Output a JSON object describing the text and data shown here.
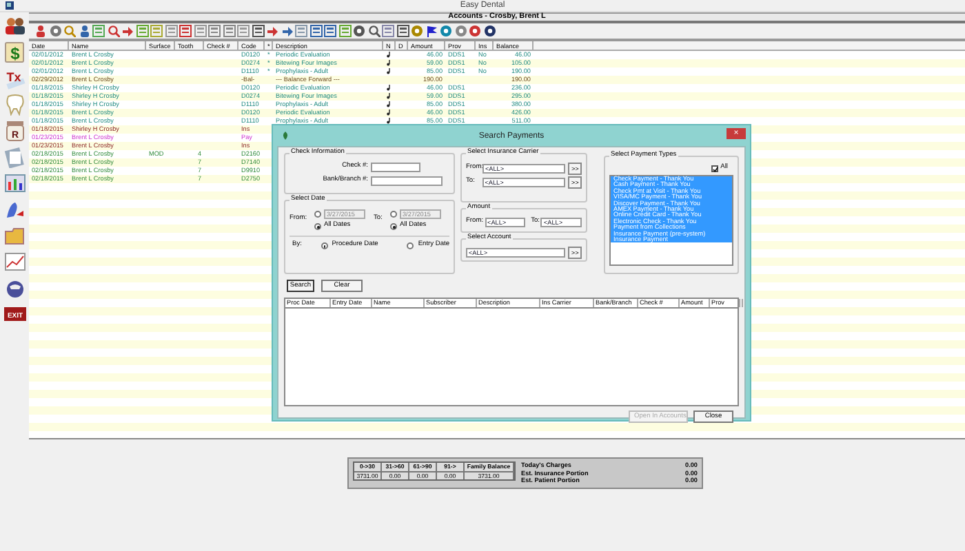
{
  "window": {
    "title": "Easy Dental"
  },
  "sidebar_labels": {
    "ledger": "$",
    "treatment": "Tx",
    "rx": "R",
    "exit": "EXIT"
  },
  "account_title": "Accounts - Crosby, Brent L",
  "ledger": {
    "columns": [
      "Date",
      "Name",
      "Surface",
      "Tooth",
      "Check #",
      "Code",
      "*",
      "Description",
      "N",
      "D",
      "Amount",
      "Prov",
      "Ins",
      "Balance"
    ],
    "rows": [
      {
        "kind": "completed",
        "date": "02/01/2012",
        "name": "Brent L Crosby",
        "code": "D0120",
        "star": "*",
        "description": "Periodic Evaluation",
        "note": true,
        "amount": "46.00",
        "prov": "DDS1",
        "ins": "No",
        "balance": "46.00"
      },
      {
        "kind": "completed",
        "date": "02/01/2012",
        "name": "Brent L Crosby",
        "code": "D0274",
        "star": "*",
        "description": "Bitewing Four Images",
        "note": true,
        "amount": "59.00",
        "prov": "DDS1",
        "ins": "No",
        "balance": "105.00"
      },
      {
        "kind": "completed",
        "date": "02/01/2012",
        "name": "Brent L Crosby",
        "code": "D1110",
        "star": "*",
        "description": "Prophylaxis - Adult",
        "note": true,
        "amount": "85.00",
        "prov": "DDS1",
        "ins": "No",
        "balance": "190.00"
      },
      {
        "kind": "balance",
        "date": "02/29/2012",
        "name": "Brent L Crosby",
        "code": "-Bal-",
        "description": "--- Balance Forward ---",
        "note": false,
        "amount": "190.00",
        "balance": "190.00"
      },
      {
        "kind": "completed",
        "date": "01/18/2015",
        "name": "Shirley H Crosby",
        "code": "D0120",
        "description": "Periodic Evaluation",
        "note": true,
        "amount": "46.00",
        "prov": "DDS1",
        "balance": "236.00"
      },
      {
        "kind": "completed",
        "date": "01/18/2015",
        "name": "Shirley H Crosby",
        "code": "D0274",
        "description": "Bitewing Four Images",
        "note": true,
        "amount": "59.00",
        "prov": "DDS1",
        "balance": "295.00"
      },
      {
        "kind": "completed",
        "date": "01/18/2015",
        "name": "Shirley H Crosby",
        "code": "D1110",
        "description": "Prophylaxis - Adult",
        "note": true,
        "amount": "85.00",
        "prov": "DDS1",
        "balance": "380.00"
      },
      {
        "kind": "completed",
        "date": "01/18/2015",
        "name": "Brent L Crosby",
        "code": "D0120",
        "description": "Periodic Evaluation",
        "note": true,
        "amount": "46.00",
        "prov": "DDS1",
        "balance": "426.00"
      },
      {
        "kind": "completed",
        "date": "01/18/2015",
        "name": "Brent L Crosby",
        "code": "D1110",
        "description": "Prophylaxis - Adult",
        "note": true,
        "amount": "85.00",
        "prov": "DDS1",
        "balance": "511.00"
      },
      {
        "kind": "insurance",
        "date": "01/18/2015",
        "name": "Shirley H Crosby",
        "code": "Ins"
      },
      {
        "kind": "payment",
        "date": "01/23/2015",
        "name": "Brent L Crosby",
        "code": "Pay"
      },
      {
        "kind": "insurance",
        "date": "01/23/2015",
        "name": "Brent L Crosby",
        "code": "Ins"
      },
      {
        "kind": "planned",
        "date": "02/18/2015",
        "name": "Brent L Crosby",
        "surface": "MOD",
        "tooth": "4",
        "code": "D2160"
      },
      {
        "kind": "planned",
        "date": "02/18/2015",
        "name": "Brent L Crosby",
        "tooth": "7",
        "code": "D7140"
      },
      {
        "kind": "planned",
        "date": "02/18/2015",
        "name": "Brent L Crosby",
        "tooth": "7",
        "code": "D9910"
      },
      {
        "kind": "planned",
        "date": "02/18/2015",
        "name": "Brent L Crosby",
        "tooth": "7",
        "code": "D2750"
      }
    ]
  },
  "summary": {
    "aging_columns": [
      "0->30",
      "31->60",
      "61->90",
      "91->",
      "Family Balance"
    ],
    "aging_values": [
      "3731.00",
      "0.00",
      "0.00",
      "0.00",
      "3731.00"
    ],
    "totals": [
      {
        "label": "Today's Charges",
        "value": "0.00"
      },
      {
        "label": "Est. Insurance Portion",
        "value": "0.00"
      },
      {
        "label": "Est. Patient Portion",
        "value": "0.00"
      }
    ]
  },
  "dialog": {
    "title": "Search Payments",
    "close": "×",
    "check_info": {
      "title": "Check Information",
      "check_label": "Check #:",
      "bank_label": "Bank/Branch #:"
    },
    "select_date": {
      "title": "Select Date",
      "from_label": "From:",
      "to_label": "To:",
      "from": {
        "specific_selected": false,
        "date": "3/27/2015",
        "all_label": "All Dates",
        "all_selected": true
      },
      "to": {
        "specific_selected": false,
        "date": "3/27/2015",
        "all_label": "All Dates",
        "all_selected": true
      },
      "by_label": "By:",
      "by_options": [
        {
          "label": "Procedure Date",
          "selected": true
        },
        {
          "label": "Entry Date",
          "selected": false
        }
      ]
    },
    "search_button": "Search",
    "clear_button": "Clear",
    "insurance": {
      "title": "Select Insurance Carrier",
      "from_label": "From:",
      "from_value": "<ALL>",
      "to_label": "To:",
      "to_value": "<ALL>",
      "more": ">>"
    },
    "amount": {
      "title": "Amount",
      "from_label": "From:",
      "from_value": "<ALL>",
      "to_label": "To:",
      "to_value": "<ALL>"
    },
    "account": {
      "title": "Select Account",
      "value": "<ALL>",
      "more": ">>"
    },
    "payment_types": {
      "title": "Select Payment Types",
      "all_label": "All",
      "all_checked": true,
      "items": [
        {
          "label": "Check Payment - Thank You",
          "selected": true
        },
        {
          "label": "Cash Payment - Thank You",
          "selected": true
        },
        {
          "label": "Check Pmt at Visit - Thank You",
          "selected": true
        },
        {
          "label": "VISA/MC Payment - Thank You",
          "selected": true
        },
        {
          "label": "Discover Payment - Thank You",
          "selected": true
        },
        {
          "label": "AMEX Payment - Thank You",
          "selected": true
        },
        {
          "label": "Online Credit Card - Thank You",
          "selected": true
        },
        {
          "label": "Electronic Check - Thank You",
          "selected": true
        },
        {
          "label": "Payment from Collections",
          "selected": true
        },
        {
          "label": "Insurance Payment (pre-system)",
          "selected": true
        },
        {
          "label": "Insurance Payment",
          "selected": true
        }
      ]
    },
    "results_columns": [
      "Proc Date",
      "Entry Date",
      "Name",
      "Subscriber",
      "Description",
      "Ins Carrier",
      "Bank/Branch",
      "Check #",
      "Amount",
      "Prov"
    ],
    "open_button": {
      "label": "Open In Accounts",
      "disabled": true
    },
    "close_button": "Close"
  }
}
